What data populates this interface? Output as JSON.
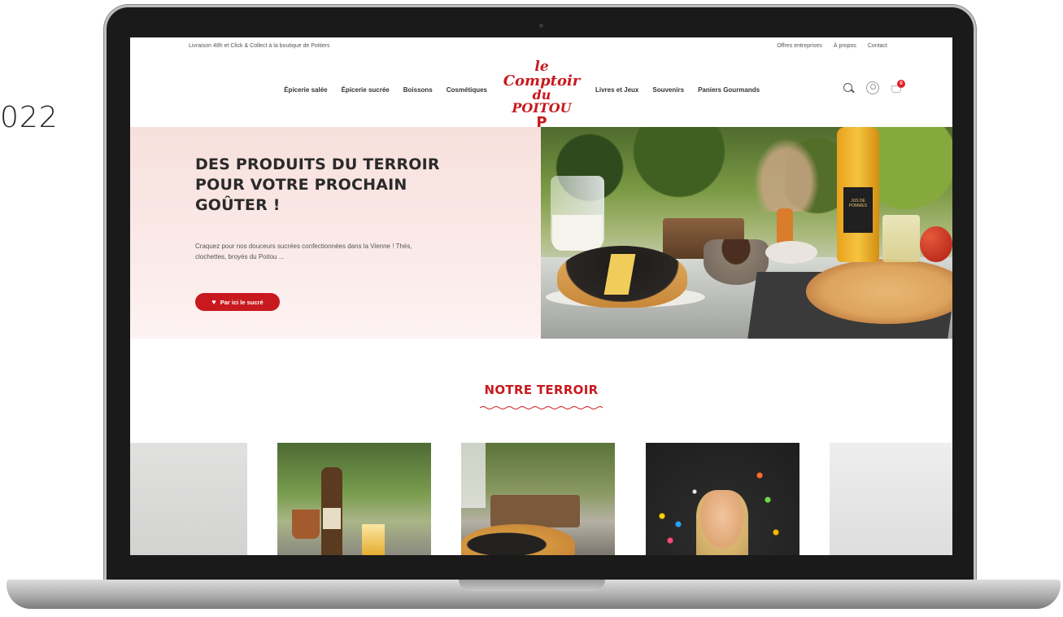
{
  "side_text": "022",
  "topbar": {
    "delivery_text": "Livraison 48h et Click & Collect à la boutique de Poitiers",
    "links": [
      "Offres entreprises",
      "À propos",
      "Contact"
    ]
  },
  "nav": {
    "left_items": [
      "Épicerie salée",
      "Épicerie sucrée",
      "Boissons",
      "Cosmétiques"
    ],
    "right_items": [
      "Livres et Jeux",
      "Souvenirs",
      "Paniers Gourmands"
    ],
    "logo": {
      "line1": "le",
      "line2": "Comptoir",
      "line3": "du POITOU",
      "line4": "P"
    },
    "icons": [
      "search-icon",
      "user-icon",
      "cart-icon"
    ],
    "cart_count": "0"
  },
  "hero": {
    "title_lines": [
      "DES PRODUITS DU TERROIR",
      "POUR VOTRE PROCHAIN",
      "GOÛTER !"
    ],
    "text_lines": [
      "Craquez pour nos douceurs sucrées confectionnées dans la Vienne ! Thés,",
      "clochettes, broyés du Poitou ..."
    ],
    "button_label": "Par ici le sucré",
    "bottle_label": "JUS DE POMMES"
  },
  "section": {
    "title": "NOTRE TERROIR"
  },
  "colors": {
    "brand_red": "#c8191f",
    "hero_bg": "#f9e4e1",
    "text_dark": "#2a2a2a"
  }
}
